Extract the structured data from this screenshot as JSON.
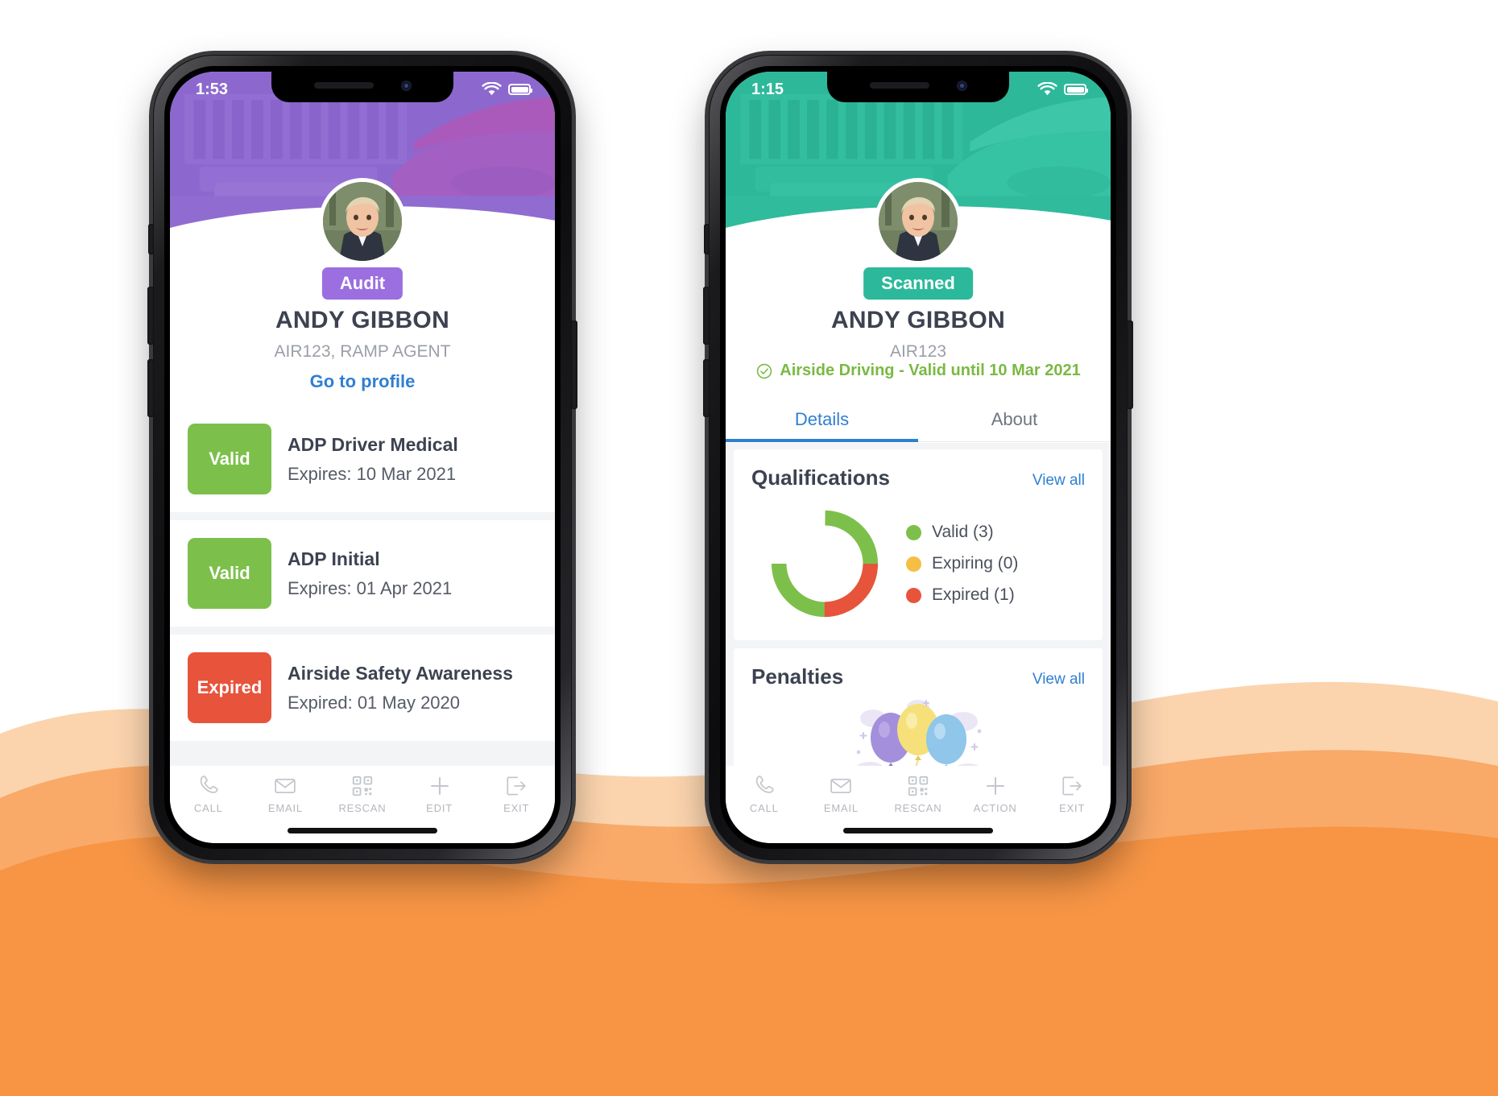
{
  "background": {
    "page_bg": "#ffffff",
    "wave_light": "#fbd4ae",
    "wave_mid": "#f9a968",
    "wave_dark": "#f79545"
  },
  "phones": [
    {
      "id": "left",
      "theme_color": "#8a63d2",
      "status": {
        "time": "1:53",
        "wifi_icon": "wifi-icon",
        "battery_icon": "battery-icon"
      },
      "badge": {
        "label": "Audit",
        "color": "#9b6fe0"
      },
      "name": "ANDY GIBBON",
      "subtitle": "AIR123, RAMP AGENT",
      "profile_link": "Go to profile",
      "qualifications": [
        {
          "status": "Valid",
          "status_color": "#7cc04b",
          "title": "ADP Driver Medical",
          "expiry": "Expires: 10 Mar 2021"
        },
        {
          "status": "Valid",
          "status_color": "#7cc04b",
          "title": "ADP Initial",
          "expiry": "Expires: 01 Apr 2021"
        },
        {
          "status": "Expired",
          "status_color": "#e8533c",
          "title": "Airside Safety Awareness",
          "expiry": "Expired: 01 May 2020"
        }
      ],
      "tabbar": [
        {
          "label": "CALL",
          "icon": "phone-icon"
        },
        {
          "label": "EMAIL",
          "icon": "envelope-icon"
        },
        {
          "label": "RESCAN",
          "icon": "qr-code-icon"
        },
        {
          "label": "EDIT",
          "icon": "plus-icon"
        },
        {
          "label": "EXIT",
          "icon": "exit-icon"
        }
      ]
    },
    {
      "id": "right",
      "theme_color": "#2cb99b",
      "status": {
        "time": "1:15",
        "wifi_icon": "wifi-icon",
        "battery_icon": "battery-icon"
      },
      "badge": {
        "label": "Scanned",
        "color": "#2cb99b"
      },
      "name": "ANDY GIBBON",
      "subtitle": "AIR123",
      "validity": {
        "icon": "check-circle-icon",
        "text": "Airside Driving - Valid until 10 Mar 2021",
        "color": "#7ab943"
      },
      "tabs": [
        {
          "label": "Details",
          "active": true
        },
        {
          "label": "About",
          "active": false
        }
      ],
      "panels": [
        {
          "title": "Qualifications",
          "view_all": "View all"
        },
        {
          "title": "Penalties",
          "view_all": "View all"
        }
      ],
      "tabbar": [
        {
          "label": "CALL",
          "icon": "phone-icon"
        },
        {
          "label": "EMAIL",
          "icon": "envelope-icon"
        },
        {
          "label": "RESCAN",
          "icon": "qr-code-icon"
        },
        {
          "label": "ACTION",
          "icon": "plus-icon"
        },
        {
          "label": "EXIT",
          "icon": "exit-icon"
        }
      ]
    }
  ],
  "chart_data": {
    "type": "pie",
    "title": "Qualifications",
    "categories": [
      "Valid",
      "Expiring",
      "Expired"
    ],
    "values": [
      3,
      0,
      1
    ],
    "colors": [
      "#7cc04b",
      "#f4bf42",
      "#e8533c"
    ],
    "legend": [
      {
        "label": "Valid (3)",
        "color": "#7cc04b"
      },
      {
        "label": "Expiring (0)",
        "color": "#f4bf42"
      },
      {
        "label": "Expired (1)",
        "color": "#e8533c"
      }
    ],
    "legend_position": "right",
    "grid": false,
    "donut": true
  }
}
